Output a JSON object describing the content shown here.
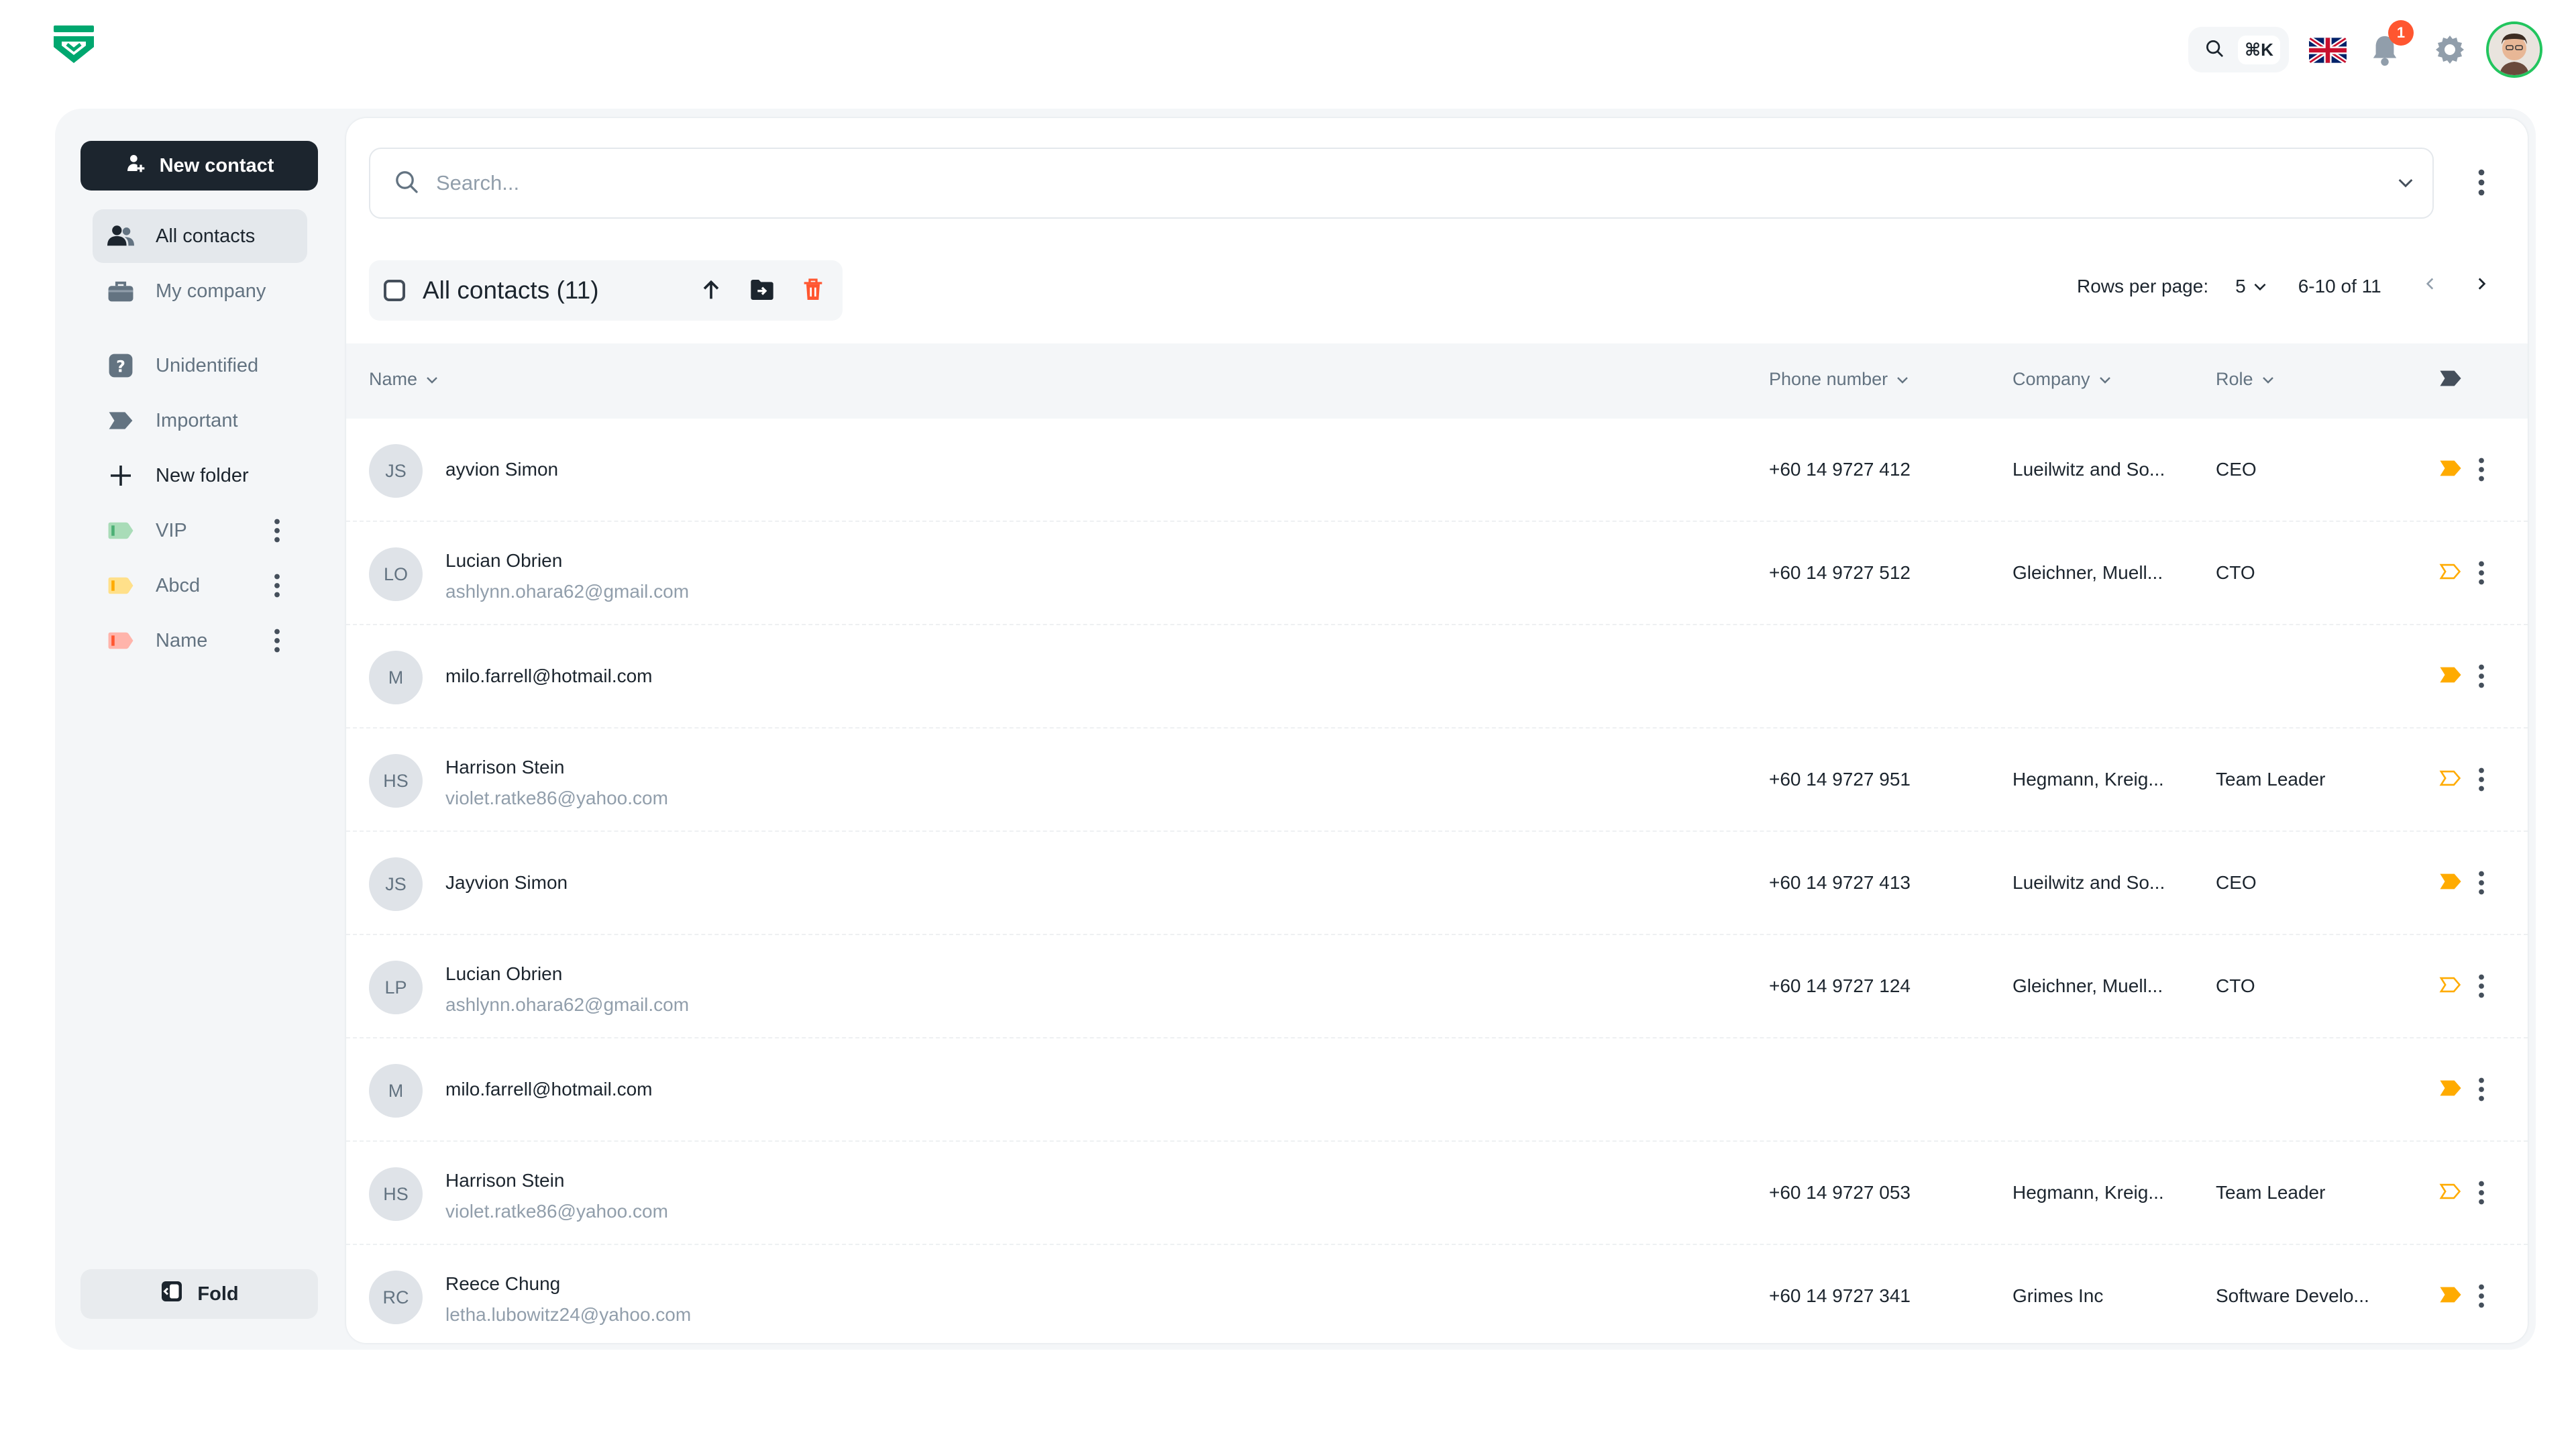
{
  "topbar": {
    "logo_icon": "brand-shield-logo",
    "search_shortcut": "⌘K",
    "notification_count": "1",
    "language_flag": "uk-flag-icon"
  },
  "sidebar": {
    "new_contact_label": "New contact",
    "items": [
      {
        "label": "All contacts",
        "icon": "users-icon"
      },
      {
        "label": "My company",
        "icon": "briefcase-icon"
      },
      {
        "label": "Unidentified",
        "icon": "question-icon"
      },
      {
        "label": "Important",
        "icon": "label-icon"
      },
      {
        "label": "New folder",
        "icon": "plus-icon"
      },
      {
        "label": "VIP",
        "icon": "label-icon",
        "color": "#86c89c"
      },
      {
        "label": "Abcd",
        "icon": "label-icon",
        "color": "#ffd666"
      },
      {
        "label": "Name",
        "icon": "label-icon",
        "color": "#ff8a80"
      }
    ],
    "fold_label": "Fold"
  },
  "search": {
    "placeholder": "Search..."
  },
  "toolbar": {
    "title": "All contacts (11)"
  },
  "pager": {
    "rows_per_page_label": "Rows per page:",
    "rows_per_page_value": "5",
    "range": "6-10 of 11"
  },
  "table": {
    "columns": {
      "name": "Name",
      "phone": "Phone number",
      "company": "Company",
      "role": "Role"
    },
    "rows": [
      {
        "initials": "JS",
        "name": "ayvion Simon",
        "email": "",
        "phone": "+60 14 9727 412",
        "company": "Lueilwitz and So...",
        "role": "CEO",
        "important": true
      },
      {
        "initials": "LO",
        "name": "Lucian Obrien",
        "email": "ashlynn.ohara62@gmail.com",
        "phone": "+60 14 9727 512",
        "company": "Gleichner, Muell...",
        "role": "CTO",
        "important": false
      },
      {
        "initials": "M",
        "name": "milo.farrell@hotmail.com",
        "email": "",
        "phone": "",
        "company": "",
        "role": "",
        "important": true
      },
      {
        "initials": "HS",
        "name": "Harrison Stein",
        "email": "violet.ratke86@yahoo.com",
        "phone": "+60 14 9727 951",
        "company": "Hegmann, Kreig...",
        "role": "Team Leader",
        "important": false
      },
      {
        "initials": "JS",
        "name": "Jayvion Simon",
        "email": "",
        "phone": "+60 14 9727 413",
        "company": "Lueilwitz and So...",
        "role": "CEO",
        "important": true
      },
      {
        "initials": "LP",
        "name": "Lucian Obrien",
        "email": "ashlynn.ohara62@gmail.com",
        "phone": "+60 14 9727 124",
        "company": "Gleichner, Muell...",
        "role": "CTO",
        "important": false
      },
      {
        "initials": "M",
        "name": "milo.farrell@hotmail.com",
        "email": "",
        "phone": "",
        "company": "",
        "role": "",
        "important": true
      },
      {
        "initials": "HS",
        "name": "Harrison Stein",
        "email": "violet.ratke86@yahoo.com",
        "phone": "+60 14 9727 053",
        "company": "Hegmann, Kreig...",
        "role": "Team Leader",
        "important": false
      },
      {
        "initials": "RC",
        "name": "Reece Chung",
        "email": "letha.lubowitz24@yahoo.com",
        "phone": "+60 14 9727 341",
        "company": "Grimes Inc",
        "role": "Software Develo...",
        "important": true
      }
    ]
  },
  "colors": {
    "brand_green": "#00a76f",
    "accent_orange": "#ffab00",
    "dark": "#1c252e",
    "danger": "#ff5630"
  }
}
